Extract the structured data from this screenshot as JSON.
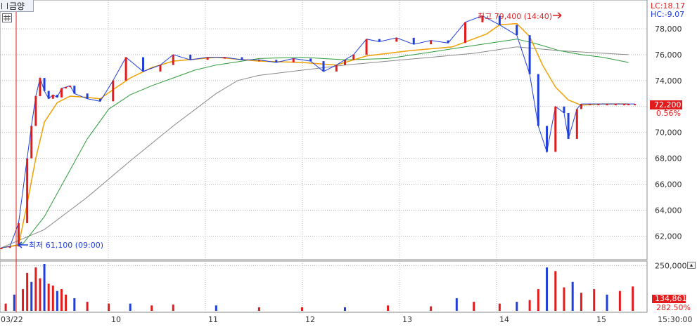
{
  "toolbar": {
    "tab_label": "금양",
    "menu_icon": "hamburger-icon",
    "grid_icon": "grid-icon"
  },
  "readout": {
    "lc": "LC:18.17",
    "hc": "HC:-9.07"
  },
  "current": {
    "price_label": "72,200",
    "change_label": "0.56%"
  },
  "volume_current": {
    "value_label": "134,861",
    "pct_label": "282.50%"
  },
  "annotations": {
    "high_label": "최고 79,400 (14:40)",
    "low_label": "최저 61,100 (09:00)"
  },
  "colors": {
    "up": "#e21c1c",
    "down": "#1f3fd8",
    "ma5": "#1f3fd8",
    "ma10": "#333333",
    "ma20": "#f0a000",
    "ma60": "#2e9a3a",
    "ma120": "#888888",
    "grid": "#b4b4b4",
    "cursor": "#e21c1c"
  },
  "chart_data": {
    "type": "line",
    "price_axis": {
      "ticks": [
        62000,
        64000,
        66000,
        68000,
        70000,
        72000,
        74000,
        76000,
        78000
      ],
      "tick_labels": [
        "62,000",
        "64,000",
        "66,000",
        "68,000",
        "70,000",
        "72,000",
        "74,000",
        "76,000",
        "78,000"
      ],
      "ylim": [
        60400,
        80000
      ]
    },
    "volume_axis": {
      "ticks": [
        250000
      ],
      "tick_labels": [
        "250,000"
      ]
    },
    "x_axis": {
      "labels": [
        "03/22",
        "10",
        "11",
        "12",
        "13",
        "14",
        "15",
        "15:30:00"
      ]
    },
    "series": [
      {
        "name": "price",
        "x": [
          0,
          4,
          8,
          12,
          14,
          16,
          18,
          20,
          22,
          24,
          26,
          28,
          30,
          32,
          34,
          40,
          46,
          52,
          58,
          66,
          74,
          80,
          88,
          96,
          104,
          112,
          120,
          128,
          136,
          144,
          150,
          156,
          160,
          164,
          170,
          176,
          184,
          192,
          200,
          208,
          216,
          224,
          232,
          240,
          246,
          250,
          254,
          258,
          262,
          264,
          268,
          270,
          274,
          278,
          282,
          286,
          290,
          292,
          295
        ],
        "y": [
          61100,
          61200,
          63000,
          68000,
          70500,
          72800,
          74200,
          73200,
          72600,
          72900,
          72700,
          73400,
          73500,
          73600,
          73000,
          72600,
          72400,
          74000,
          75800,
          74700,
          75200,
          76000,
          75600,
          75800,
          75800,
          75600,
          75600,
          75400,
          75700,
          75500,
          74700,
          75200,
          75600,
          76000,
          77200,
          77000,
          77300,
          76800,
          77100,
          76900,
          78500,
          79000,
          78300,
          77500,
          74500,
          70500,
          68500,
          72000,
          71500,
          69500,
          71800,
          72200,
          72200,
          72200,
          72200,
          72200,
          72200,
          72200,
          72200
        ]
      },
      {
        "name": "ma20",
        "x": [
          0,
          8,
          12,
          16,
          20,
          26,
          32,
          40,
          46,
          52,
          60,
          70,
          80,
          100,
          120,
          140,
          156,
          170,
          190,
          210,
          226,
          232,
          240,
          246,
          252,
          258,
          264,
          270,
          280,
          292
        ],
        "y": [
          61100,
          61300,
          64500,
          68000,
          70800,
          72300,
          72800,
          72700,
          72600,
          73300,
          74200,
          75000,
          75500,
          75800,
          75500,
          75400,
          75200,
          75900,
          76300,
          76600,
          77600,
          78300,
          78400,
          77400,
          75200,
          73500,
          72500,
          72100,
          72200,
          72200
        ]
      },
      {
        "name": "ma60",
        "x": [
          0,
          10,
          20,
          30,
          40,
          50,
          60,
          70,
          80,
          90,
          100,
          120,
          140,
          160,
          180,
          200,
          220,
          232,
          240,
          250,
          260,
          270,
          280,
          292
        ],
        "y": [
          61100,
          61400,
          63500,
          66500,
          69500,
          71800,
          72900,
          73600,
          74200,
          74800,
          75200,
          75700,
          75800,
          75600,
          75700,
          76200,
          76700,
          77000,
          77200,
          76800,
          76300,
          76000,
          75800,
          75400
        ]
      },
      {
        "name": "ma120",
        "x": [
          0,
          20,
          40,
          60,
          80,
          100,
          110,
          120,
          140,
          160,
          180,
          200,
          220,
          240,
          260,
          292
        ],
        "y": [
          61100,
          62500,
          65000,
          67800,
          70500,
          73000,
          74000,
          74400,
          74800,
          75200,
          75500,
          75800,
          76100,
          76600,
          76300,
          76000
        ]
      },
      {
        "name": "volume",
        "x": [
          2,
          6,
          10,
          12,
          14,
          16,
          18,
          20,
          22,
          24,
          26,
          28,
          30,
          34,
          40,
          50,
          60,
          70,
          80,
          100,
          120,
          140,
          160,
          180,
          200,
          212,
          220,
          232,
          240,
          246,
          250,
          254,
          258,
          262,
          266,
          270,
          276,
          282,
          288,
          294
        ],
        "y": [
          40000,
          90000,
          120000,
          210000,
          160000,
          240000,
          180000,
          260000,
          150000,
          140000,
          110000,
          120000,
          90000,
          70000,
          50000,
          40000,
          40000,
          30000,
          35000,
          30000,
          20000,
          20000,
          20000,
          30000,
          25000,
          70000,
          50000,
          40000,
          50000,
          60000,
          120000,
          240000,
          220000,
          130000,
          160000,
          100000,
          120000,
          90000,
          110000,
          134861
        ]
      }
    ]
  }
}
